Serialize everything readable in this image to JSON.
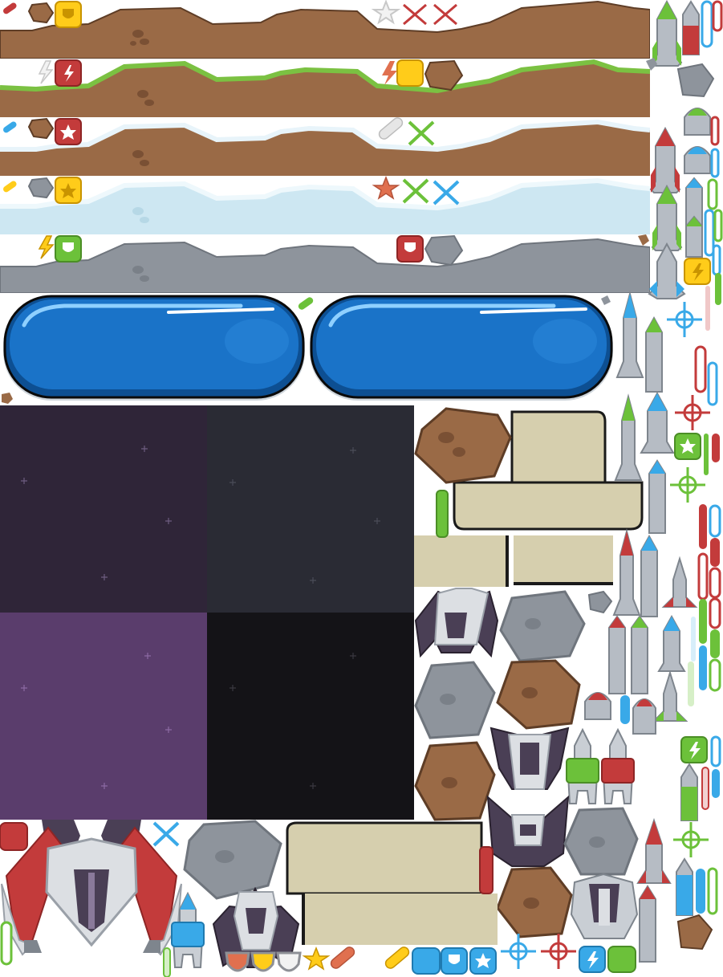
{
  "sheet": {
    "kind": "sprite-sheet",
    "theme": "space-shooter",
    "colors": {
      "dirt": "#9a6a46",
      "dirt_dark": "#7a5034",
      "grass": "#7bc142",
      "snow": "#e8f4fa",
      "ice": "#cde7f2",
      "rock": "#8e949c",
      "rock_dark": "#6f757d",
      "button_blue": "#1a73c8",
      "button_dark": "#0d4f92",
      "space_purple_dark": "#2f2538",
      "space_gray": "#2a2b34",
      "space_purple": "#5a3d6c",
      "space_black": "#141317",
      "panel": "#d6cfae",
      "ship_red": "#c33b3b",
      "ship_silver": "#dcdfe3",
      "ship_dark": "#4a3f55",
      "accent_yellow": "#ffcc1a",
      "accent_green": "#6cc13a",
      "accent_blue": "#39a9e8",
      "accent_white": "#f2f2f2"
    },
    "terrain_strips": [
      "dirt",
      "grass",
      "snow-dirt",
      "ice",
      "rock"
    ],
    "space_tiles": [
      "purple-dark",
      "gray",
      "purple",
      "black"
    ],
    "icons": [
      "pill-icon",
      "meteor-icon",
      "shield-badge-icon",
      "bolt-icon",
      "star-icon",
      "cross-icon",
      "crosshair-icon"
    ]
  }
}
